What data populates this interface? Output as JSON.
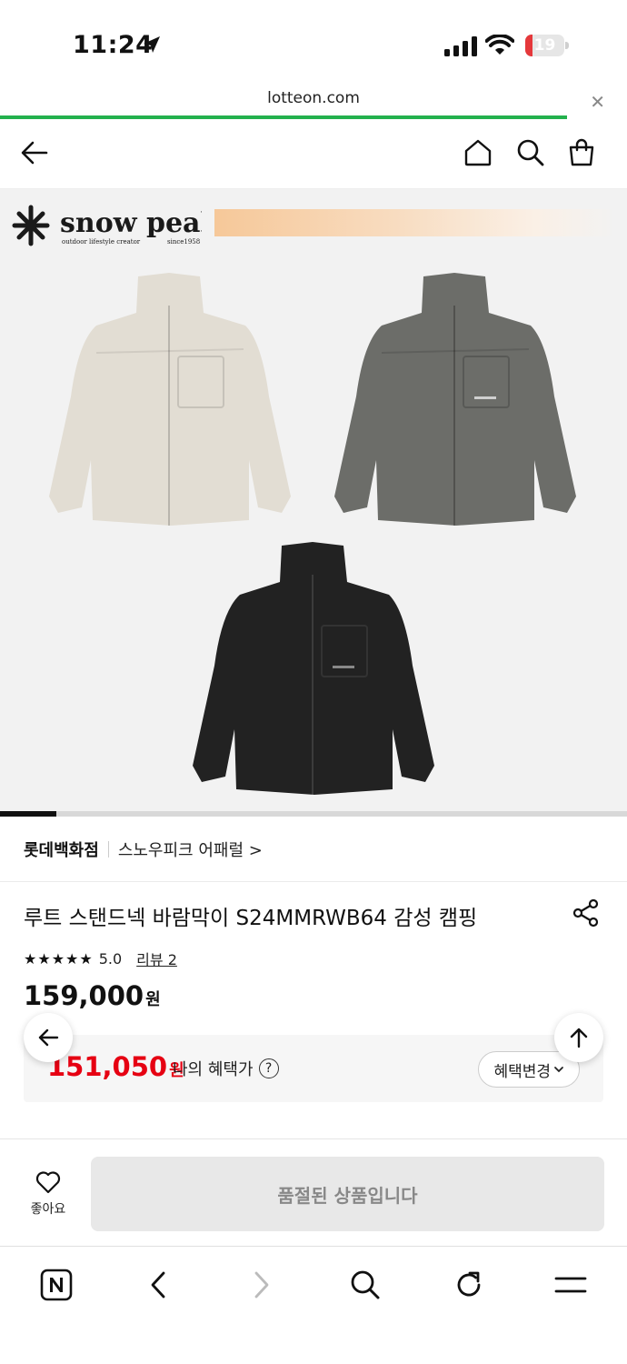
{
  "status_bar": {
    "time": "11:24",
    "battery": "19",
    "battery_level": 0.19,
    "icons": [
      "location-arrow-icon",
      "signal-icon",
      "wifi-icon",
      "battery-icon"
    ]
  },
  "browser": {
    "url": "lotteon.com",
    "close_icon": "close-icon",
    "load_progress": 0.905
  },
  "header": {
    "icons": [
      "back-arrow-icon",
      "home-icon",
      "search-icon",
      "cart-icon"
    ]
  },
  "product_image": {
    "brand_name": "snow peak",
    "brand_tagline": "outdoor lifestyle creator",
    "brand_since": "since1958",
    "jacket_colors": [
      "#e2ddd3",
      "#6c6d69",
      "#222222"
    ],
    "slide_progress": 0.09
  },
  "store": {
    "name": "롯데백화점",
    "brand_link": "스노우피크 어패럴 >"
  },
  "product": {
    "title": "루트 스탠드넥 바람막이 S24MMRWB64 감성 캠핑",
    "stars": "★★★★★",
    "rating": "5.0",
    "review_link": "리뷰 2",
    "price": "159,000",
    "price_unit": "원"
  },
  "benefit": {
    "price": "151,050",
    "unit": "원",
    "label": "나의 혜택가",
    "help": "?",
    "change_button": "혜택변경"
  },
  "purchase_bar": {
    "like_label": "좋아요",
    "soldout_label": "품절된 상품입니다"
  },
  "toolbar": {
    "icons": [
      "naver-icon",
      "back-icon",
      "forward-icon",
      "search-icon",
      "refresh-icon",
      "menu-icon"
    ]
  },
  "colors": {
    "accent_green": "#23b14d",
    "sale_red": "#e60012",
    "battery_red": "#e5383b"
  }
}
